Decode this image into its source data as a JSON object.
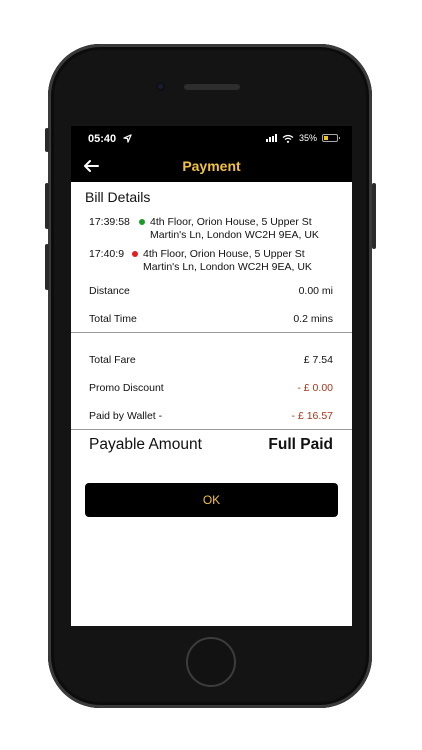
{
  "status": {
    "time": "05:40",
    "battery": "35%",
    "battery_level": 0.35
  },
  "header": {
    "title": "Payment"
  },
  "bill": {
    "title": "Bill Details",
    "pickup": {
      "time": "17:39:58",
      "address_line1": "4th Floor, Orion House, 5 Upper St",
      "address_line2": "Martin's Ln, London WC2H 9EA, UK",
      "dot_color": "#1a9a2a"
    },
    "dropoff": {
      "time": "17:40:9",
      "address_line1": "4th Floor, Orion House, 5 Upper St",
      "address_line2": "Martin's Ln, London WC2H 9EA, UK",
      "dot_color": "#e0201a"
    },
    "distance": {
      "label": "Distance",
      "value": "0.00 mi"
    },
    "total_time": {
      "label": "Total Time",
      "value": "0.2 mins"
    },
    "total_fare": {
      "label": "Total Fare",
      "value": "£ 7.54"
    },
    "promo": {
      "label": "Promo Discount",
      "value": "- £ 0.00"
    },
    "wallet": {
      "label": "Paid by Wallet -",
      "value": "- £ 16.57"
    },
    "payable": {
      "label": "Payable Amount",
      "value": "Full Paid"
    }
  },
  "actions": {
    "ok_label": "OK"
  },
  "colors": {
    "accent": "#f0c23d",
    "negative": "#a8341a",
    "bar": "#000000"
  }
}
